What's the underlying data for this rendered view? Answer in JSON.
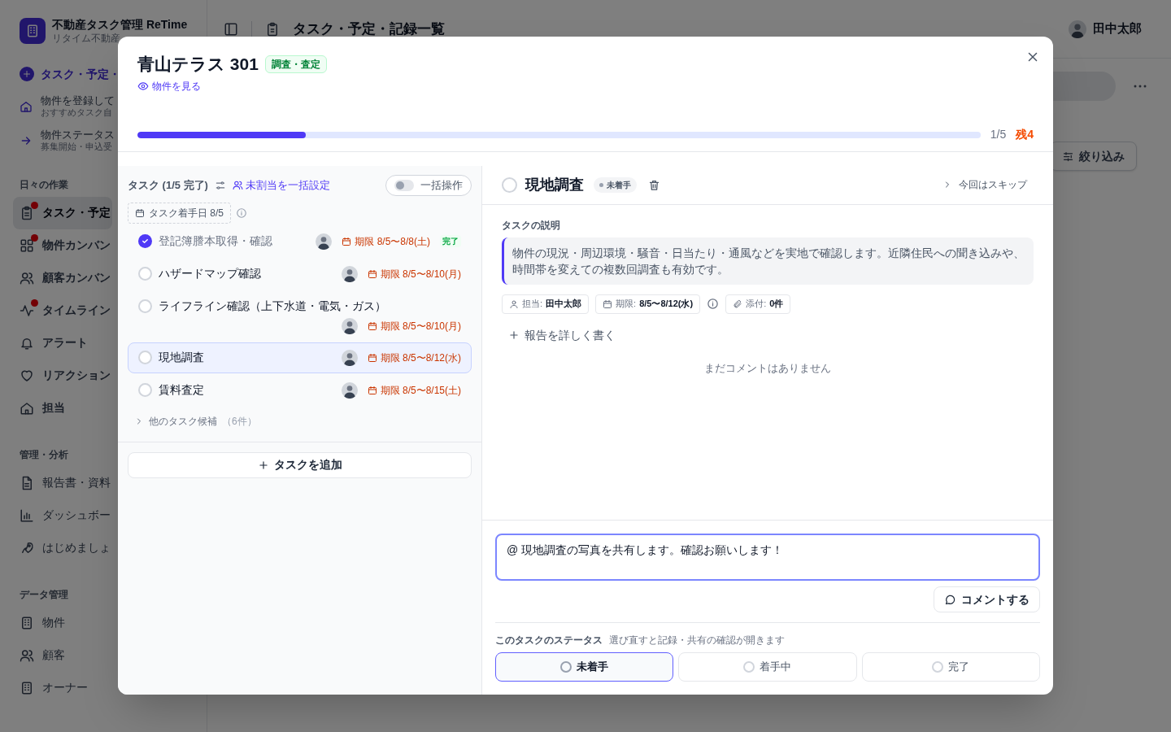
{
  "app": {
    "name": "不動産タスク管理 ReTime",
    "subtitle": "リタイム不動産"
  },
  "sidebar": {
    "primary_action": "タスク・予定・",
    "shortcuts": [
      {
        "title": "物件を登録して",
        "subtitle": "おすすめタスク自"
      },
      {
        "title": "物件ステータス",
        "subtitle": "募集開始・申込受"
      }
    ],
    "sections": [
      {
        "title": "日々の作業",
        "items": [
          {
            "label": "タスク・予定",
            "selected": true,
            "alert": true
          },
          {
            "label": "物件カンバン",
            "selected": false,
            "alert": true
          },
          {
            "label": "顧客カンバン",
            "selected": false,
            "alert": false
          },
          {
            "label": "タイムライン",
            "selected": false,
            "alert": true
          },
          {
            "label": "アラート",
            "selected": false,
            "alert": false
          },
          {
            "label": "リアクション",
            "selected": false,
            "alert": false
          },
          {
            "label": "担当",
            "selected": false,
            "alert": false
          }
        ]
      },
      {
        "title": "管理・分析",
        "items": [
          {
            "label": "報告書・資料",
            "selected": false,
            "alert": false
          },
          {
            "label": "ダッシュボー",
            "selected": false,
            "alert": false
          },
          {
            "label": "はじめましょ",
            "selected": false,
            "alert": false
          }
        ]
      },
      {
        "title": "データ管理",
        "items": [
          {
            "label": "物件",
            "selected": false,
            "alert": false
          },
          {
            "label": "顧客",
            "selected": false,
            "alert": false
          },
          {
            "label": "オーナー",
            "selected": false,
            "alert": false
          }
        ]
      }
    ]
  },
  "header": {
    "page_title": "タスク・予定・記録一覧",
    "user": "田中太郎",
    "filter_button": "絞り込み"
  },
  "modal": {
    "title": "青山テラス 301",
    "tag": "調査・査定",
    "view_link": "物件を見る",
    "progress": {
      "level": 0.2,
      "count": "1/5",
      "remaining": "残4"
    },
    "task_panel": {
      "heading": "タスク (1/5 完了)",
      "bulk_assign": "未割当を一括設定",
      "bulk_toggle": {
        "label": "一括操作",
        "on": false
      },
      "start_date": "タスク着手日 8/5",
      "tasks": [
        {
          "title": "登記簿謄本取得・確認",
          "due": "期限 8/5〜8/8(土)",
          "done": true,
          "done_label": "完了",
          "selected": false
        },
        {
          "title": "ハザードマップ確認",
          "due": "期限 8/5〜8/10(月)",
          "done": false,
          "selected": false
        },
        {
          "title": "ライフライン確認（上下水道・電気・ガス）",
          "due": "期限 8/5〜8/10(月)",
          "done": false,
          "selected": false
        },
        {
          "title": "現地調査",
          "due": "期限 8/5〜8/12(水)",
          "done": false,
          "selected": true
        },
        {
          "title": "賃料査定",
          "due": "期限 8/5〜8/15(土)",
          "done": false,
          "selected": false
        }
      ],
      "more": {
        "label": "他のタスク候補",
        "count": "（6件）",
        "expanded": false
      },
      "add_button": "タスクを追加"
    },
    "detail": {
      "title": "現地調査",
      "done": false,
      "status_badge": "未着手",
      "skip": "今回はスキップ",
      "description_label": "タスクの説明",
      "description": "物件の現況・周辺環境・騒音・日当たり・通風などを実地で確認します。近隣住民への聞き込みや、時間帯を変えての複数回調査も有効です。",
      "chips": [
        {
          "kind": "assignee",
          "label": "担当:",
          "value": "田中太郎"
        },
        {
          "kind": "due",
          "label": "期限:",
          "value": "8/5〜8/12(水)"
        },
        {
          "kind": "attachment",
          "label": "添付:",
          "value": "0件"
        }
      ],
      "write_report": "報告を詳しく書く",
      "empty_comments": "まだコメントはありません",
      "comment": {
        "value": "@ 現地調査の写真を共有します。確認お願いします！"
      },
      "comment_button": "コメントする",
      "status": {
        "label": "このタスクのステータス",
        "hint": "選び直すと記録・共有の確認が開きます",
        "options": [
          {
            "label": "未着手",
            "selected": true
          },
          {
            "label": "着手中",
            "selected": false
          },
          {
            "label": "完了",
            "selected": false
          }
        ]
      }
    }
  }
}
